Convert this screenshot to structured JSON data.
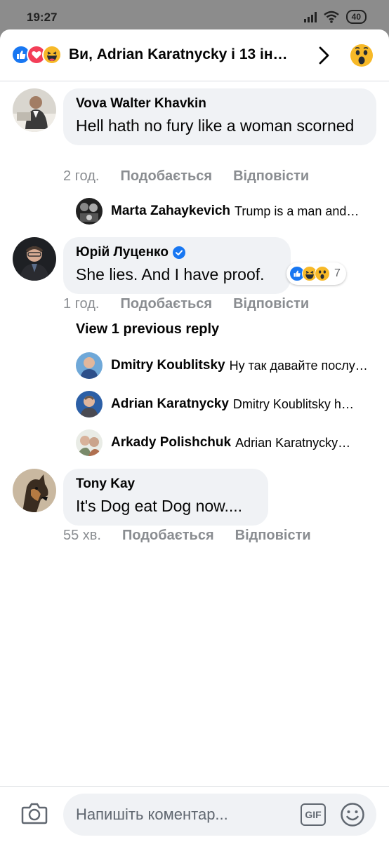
{
  "status": {
    "time": "19:27",
    "battery": "40"
  },
  "header": {
    "title": "Ви, Adrian Karatnycky і 13 ін…",
    "reaction_icons": [
      "like-icon",
      "love-icon",
      "haha-icon"
    ],
    "quick_reaction_icon": "wow-icon"
  },
  "comments": [
    {
      "name": "Vova Walter Khavkin",
      "text": "Hell hath no fury like a woman scorned",
      "time": "2 год.",
      "like_label": "Подобається",
      "reply_label": "Відповісти",
      "replies": [
        {
          "name": "Marta Zahaykevich",
          "text": "Trump is a man and…"
        }
      ]
    },
    {
      "name": "Юрій Луценко",
      "verified": true,
      "text": "She lies. And I have proof.",
      "time": "1 год.",
      "like_label": "Подобається",
      "reply_label": "Відповісти",
      "reactions": {
        "icons": [
          "like-icon",
          "haha-icon",
          "wow-icon"
        ],
        "count": "7"
      },
      "view_previous": "View 1 previous reply",
      "replies": [
        {
          "name": "Dmitry Koublitsky",
          "text": "Ну так давайте послушаем…"
        },
        {
          "name": "Adrian Karatnycky",
          "text": "Dmitry Koublitsky h…"
        },
        {
          "name": "Arkady Polishchuk",
          "text": "Adrian Karatnycky…"
        }
      ]
    },
    {
      "name": "Tony Kay",
      "text": "It's Dog eat Dog now....",
      "time": "55 хв.",
      "like_label": "Подобається",
      "reply_label": "Відповісти"
    }
  ],
  "composer": {
    "placeholder": "Напишіть коментар...",
    "gif_label": "GIF"
  },
  "colors": {
    "like": "#1877f2",
    "love": "#f33e58",
    "haha": "#f7b928",
    "bubble": "#f0f2f5",
    "meta": "#8a8d91"
  }
}
